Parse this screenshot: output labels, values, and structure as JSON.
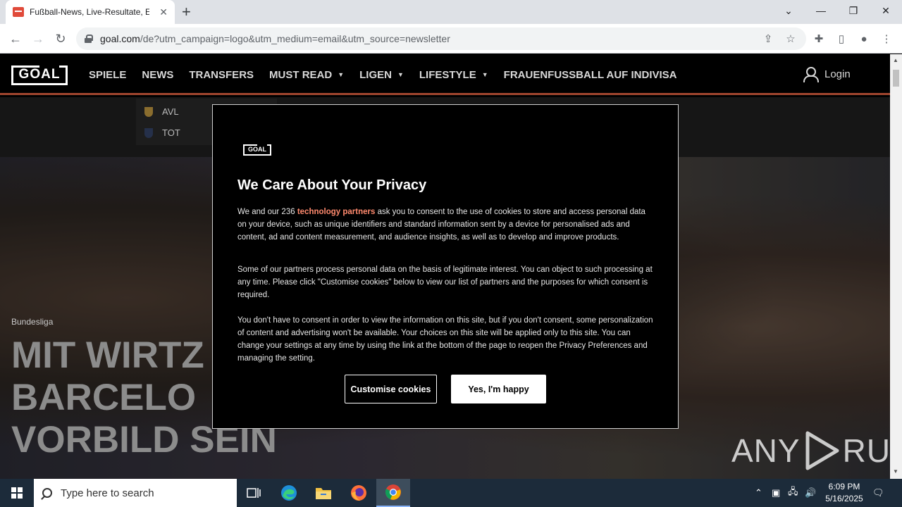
{
  "browser": {
    "tab_title": "Fußball-News, Live-Resultate, Er",
    "new_tab": "+",
    "url_host": "goal.com",
    "url_path": "/de?utm_campaign=logo&utm_medium=email&utm_source=newsletter"
  },
  "site": {
    "logo": "GOAL",
    "nav": [
      {
        "label": "SPIELE"
      },
      {
        "label": "NEWS"
      },
      {
        "label": "TRANSFERS"
      },
      {
        "label": "MUST READ",
        "dropdown": true
      },
      {
        "label": "LIGEN",
        "dropdown": true
      },
      {
        "label": "LIFESTYLE",
        "dropdown": true
      },
      {
        "label": "FRAUENFUSSBALL AUF INDIVISA"
      }
    ],
    "login": "Login",
    "match": {
      "home": "AVL",
      "away": "TOT"
    }
  },
  "hero": {
    "category": "Bundesliga",
    "headline": [
      "MIT WIRTZ",
      "BARCELO",
      "VORBILD SEIN"
    ]
  },
  "modal": {
    "logo": "GOAL",
    "title": "We Care About Your Privacy",
    "p1_before": "We and our 236 ",
    "p1_link": "technology partners",
    "p1_after": " ask you to consent to the use of cookies to store and access personal data on your device, such as unique identifiers and standard information sent by a device for personalised ads and content, ad and content measurement, and audience insights, as well as to develop and improve products.",
    "p2": "Some of our partners process personal data on the basis of legitimate interest. You can object to such processing at any time. Please click \"Customise cookies\" below to view our list of partners and the purposes for which consent is required.",
    "p3": "You don't have to consent in order to view the information on this site, but if you don't consent, some personalization of content and advertising won't be available. Your choices on this site will be applied only to this site. You can change your settings at any time by using the link at the bottom of the page to reopen the Privacy Preferences and managing the setting.",
    "btn_customise": "Customise cookies",
    "btn_accept": "Yes, I'm happy"
  },
  "watermark": {
    "left": "ANY",
    "right": "RUN"
  },
  "taskbar": {
    "search_placeholder": "Type here to search",
    "time": "6:09 PM",
    "date": "5/16/2025"
  },
  "colors": {
    "accent_link": "#ff8a6e",
    "header_rule": "#a0452e",
    "taskbar": "#1c2b3a"
  }
}
